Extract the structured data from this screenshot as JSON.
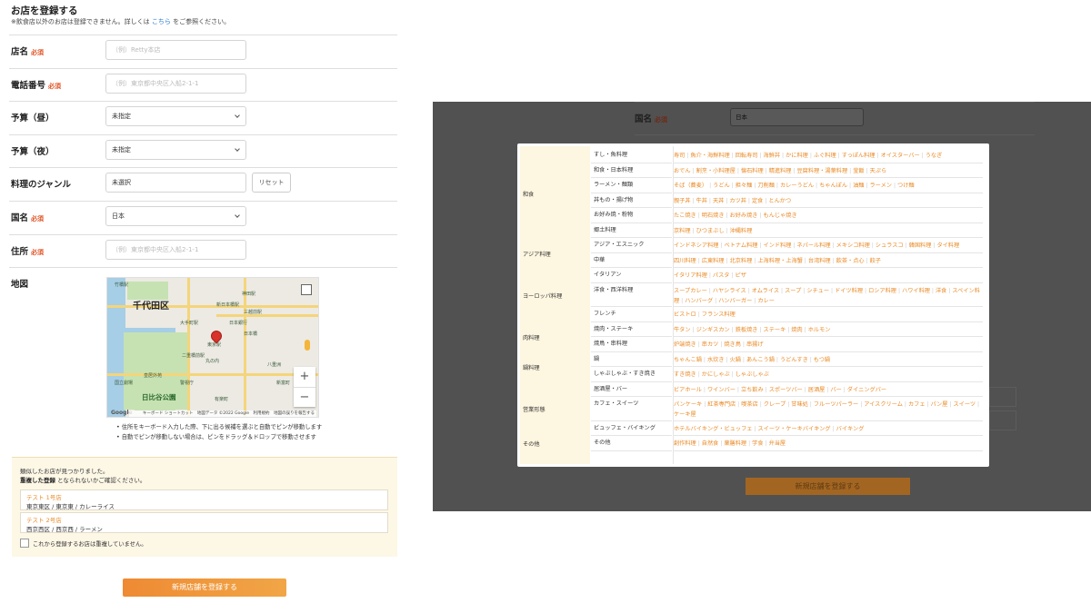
{
  "form": {
    "title": "お店を登録する",
    "note_before": "※飲食店以外のお店は登録できません。詳しくは",
    "note_link": "こちら",
    "note_after": "をご参照ください。",
    "required": "必須",
    "rows": [
      {
        "label": "店名",
        "required": true,
        "value": "（例）Retty本店",
        "placeholder": true,
        "type": "text"
      },
      {
        "label": "電話番号",
        "required": true,
        "value": "（例）東京都中央区入船2-1-1",
        "placeholder": true,
        "type": "text"
      },
      {
        "label": "予算（昼）",
        "required": false,
        "value": "未指定",
        "placeholder": false,
        "type": "select"
      },
      {
        "label": "予算（夜）",
        "required": false,
        "value": "未指定",
        "placeholder": false,
        "type": "select"
      },
      {
        "label": "料理のジャンル",
        "required": false,
        "value": "未選択",
        "placeholder": false,
        "type": "text"
      },
      {
        "label": "国名",
        "required": true,
        "value": "日本",
        "placeholder": false,
        "type": "select"
      },
      {
        "label": "住所",
        "required": true,
        "value": "（例）東京都中央区入船2-1-1",
        "placeholder": true,
        "type": "text"
      }
    ],
    "reset_label": "リセット",
    "map_label": "地図",
    "map": {
      "district": "千代田区",
      "park": "日比谷公園",
      "labels": [
        "竹橋駅",
        "神田駅",
        "新日本橋駅",
        "三越前駅",
        "日本橋",
        "東京駅",
        "大手町駅",
        "二重橋前駅",
        "日本銀行",
        "国立劇場",
        "皇居外苑",
        "警視庁",
        "丸の内",
        "八重洲",
        "新富町",
        "有楽町"
      ],
      "footer": "キーボード ショートカット　地図データ ©2022 Google　利用規約　地図の誤りを報告する",
      "zoom_in": "+",
      "zoom_out": "−",
      "google": "Google"
    },
    "bullets": [
      "住所をキーボード入力した際、下に出る候補を選ぶと自動でピンが移動します",
      "自動でピンが移動しない場合は、ピンをドラッグ＆ドロップで移動させます"
    ],
    "dup_intro": "類似したお店が見つかりました。",
    "dup_strong": "重複した登録",
    "dup_rest": "となられないかご確認ください。",
    "dup_items": [
      {
        "name": "テスト 1号店",
        "address": "東京東区 / 東京東 / カレーライス"
      },
      {
        "name": "テスト 2号店",
        "address": "西京西区 / 西京西 / ラーメン"
      }
    ],
    "dup_check_label": "これから登録するお店は重複していません。",
    "submit_label": "新規店舗を登録する"
  },
  "background": {
    "country_label": "国名",
    "required": "必須",
    "country_value": "日本",
    "submit_label": "新規店舗を登録する"
  },
  "genre_modal": {
    "groups": [
      {
        "label": "和食",
        "rows": [
          {
            "sub": "すし・魚料理",
            "items": [
              "寿司",
              "魚介・海鮮料理",
              "回転寿司",
              "海鮮丼",
              "かに料理",
              "ふぐ料理",
              "すっぽん料理",
              "オイスターバー",
              "うなぎ"
            ]
          },
          {
            "sub": "和食・日本料理",
            "items": [
              "おでん",
              "割烹・小料理屋",
              "懐石料理",
              "精進料理",
              "豆腐料理・湯葉料理",
              "釜飯",
              "天ぷら"
            ]
          },
          {
            "sub": "ラーメン・麺類",
            "items": [
              "そば（蕎麦）",
              "うどん",
              "担々麺",
              "刀削麺",
              "カレーうどん",
              "ちゃんぽん",
              "油麺",
              "ラーメン",
              "つけ麺"
            ]
          },
          {
            "sub": "丼もの・揚げ物",
            "items": [
              "親子丼",
              "牛丼",
              "天丼",
              "カツ丼",
              "定食",
              "とんかつ"
            ]
          },
          {
            "sub": "お好み焼・粉物",
            "items": [
              "たこ焼き",
              "明石焼き",
              "お好み焼き",
              "もんじゃ焼き"
            ]
          },
          {
            "sub": "郷土料理",
            "items": [
              "京料理",
              "ひつまぶし",
              "沖縄料理"
            ]
          }
        ]
      },
      {
        "label": "アジア料理",
        "rows": [
          {
            "sub": "アジア・エスニック",
            "items": [
              "インドネシア料理",
              "ベトナム料理",
              "インド料理",
              "ネパール料理",
              "メキシコ料理",
              "シュラスコ",
              "韓国料理",
              "タイ料理"
            ]
          },
          {
            "sub": "中華",
            "items": [
              "四川料理",
              "広東料理",
              "北京料理",
              "上海料理・上海蟹",
              "台湾料理",
              "飲茶・点心",
              "餃子"
            ]
          }
        ]
      },
      {
        "label": "ヨーロッパ料理",
        "rows": [
          {
            "sub": "イタリアン",
            "items": [
              "イタリア料理",
              "パスタ",
              "ピザ"
            ]
          },
          {
            "sub": "洋食・西洋料理",
            "items": [
              "スープカレー",
              "ハヤシライス",
              "オムライス",
              "スープ",
              "シチュー",
              "ドイツ料理",
              "ロシア料理",
              "ハワイ料理",
              "洋食",
              "スペイン料理",
              "ハンバーグ",
              "ハンバーガー",
              "カレー"
            ]
          },
          {
            "sub": "フレンチ",
            "items": [
              "ビストロ",
              "フランス料理"
            ]
          }
        ]
      },
      {
        "label": "肉料理",
        "rows": [
          {
            "sub": "焼肉・ステーキ",
            "items": [
              "牛タン",
              "ジンギスカン",
              "鉄板焼き",
              "ステーキ",
              "焼肉",
              "ホルモン"
            ]
          },
          {
            "sub": "焼鳥・串料理",
            "items": [
              "炉端焼き",
              "串カツ",
              "焼き鳥",
              "串揚げ"
            ]
          }
        ]
      },
      {
        "label": "鍋料理",
        "rows": [
          {
            "sub": "鍋",
            "items": [
              "ちゃんこ鍋",
              "水炊き",
              "火鍋",
              "あんこう鍋",
              "うどんすき",
              "もつ鍋"
            ]
          },
          {
            "sub": "しゃぶしゃぶ・すき焼き",
            "items": [
              "すき焼き",
              "かにしゃぶ",
              "しゃぶしゃぶ"
            ]
          }
        ]
      },
      {
        "label": "営業形態",
        "rows": [
          {
            "sub": "居酒屋・バー",
            "items": [
              "ビアホール",
              "ワインバー",
              "立ち飲み",
              "スポーツバー",
              "居酒屋",
              "バー",
              "ダイニングバー"
            ]
          },
          {
            "sub": "カフェ・スイーツ",
            "items": [
              "パンケーキ",
              "紅茶専門店",
              "喫茶店",
              "クレープ",
              "甘味処",
              "フルーツパーラー",
              "アイスクリーム",
              "カフェ",
              "パン屋",
              "スイーツ",
              "ケーキ屋"
            ]
          },
          {
            "sub": "ビュッフェ・バイキング",
            "items": [
              "ホテルバイキング・ビュッフェ",
              "スイーツ・ケーキバイキング",
              "バイキング"
            ]
          }
        ]
      },
      {
        "label": "その他",
        "rows": [
          {
            "sub": "その他",
            "items": [
              "創作料理",
              "自然食",
              "薬膳料理",
              "学食",
              "弁当屋"
            ]
          }
        ]
      }
    ]
  },
  "colors": {
    "accent": "#e98a26",
    "required": "#e05324",
    "link": "#2e7fd1"
  }
}
